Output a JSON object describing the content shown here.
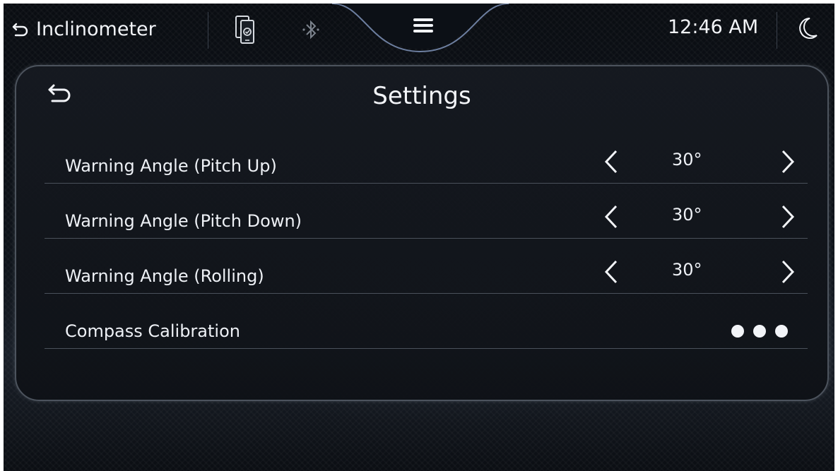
{
  "status_bar": {
    "app_title": "Inclinometer",
    "clock": "12:46 AM",
    "icons": [
      "back-arrow-icon",
      "phone-connected-icon",
      "bluetooth-icon",
      "menu-icon",
      "moon-icon"
    ]
  },
  "settings": {
    "title": "Settings",
    "rows": [
      {
        "label": "Warning Angle (Pitch Up)",
        "value": "30°"
      },
      {
        "label": "Warning Angle (Pitch Down)",
        "value": "30°"
      },
      {
        "label": "Warning Angle (Rolling)",
        "value": "30°"
      }
    ],
    "calibration": {
      "label": "Compass Calibration"
    }
  },
  "colors": {
    "background": "#0f141b",
    "text": "#eef1f6",
    "panel_border": "#4c535d",
    "divider": "#4a515b"
  }
}
